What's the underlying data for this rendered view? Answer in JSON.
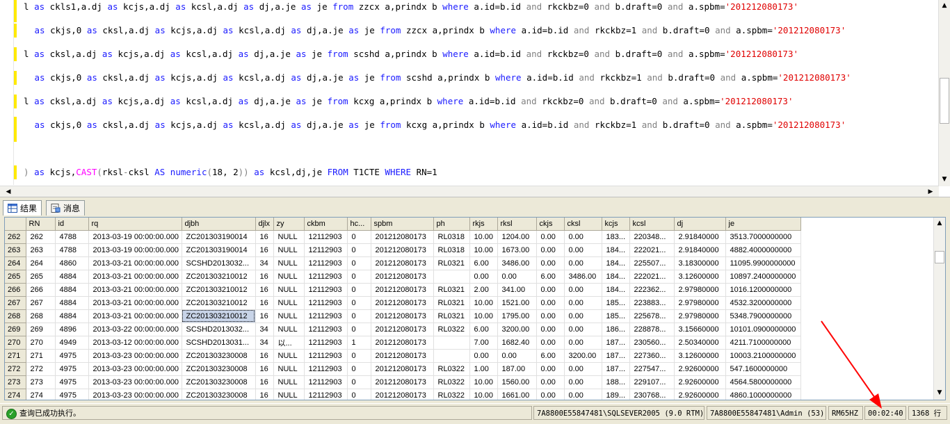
{
  "editor": {
    "lines": [
      [
        [
          "",
          "l "
        ],
        [
          "kw",
          "as"
        ],
        [
          "",
          " ckls1,a.dj "
        ],
        [
          "kw",
          "as"
        ],
        [
          "",
          " kcjs,a.dj "
        ],
        [
          "kw",
          "as"
        ],
        [
          "",
          " kcsl,a.dj "
        ],
        [
          "kw",
          "as"
        ],
        [
          "",
          " dj,a.je "
        ],
        [
          "kw",
          "as"
        ],
        [
          "",
          " je "
        ],
        [
          "kw",
          "from"
        ],
        [
          "",
          " zzcx a,prindx b "
        ],
        [
          "kw",
          "where"
        ],
        [
          "",
          " a.id=b.id "
        ],
        [
          "op",
          "and"
        ],
        [
          "",
          " rkckbz=0 "
        ],
        [
          "op",
          "and"
        ],
        [
          "",
          " b.draft=0 "
        ],
        [
          "op",
          "and"
        ],
        [
          "",
          " a.spbm="
        ],
        [
          "str",
          "'201212080173'"
        ]
      ],
      [
        [
          "",
          " "
        ],
        [
          "kw",
          "as"
        ],
        [
          "",
          " ckjs,0 "
        ],
        [
          "kw",
          "as"
        ],
        [
          "",
          " cksl,a.dj "
        ],
        [
          "kw",
          "as"
        ],
        [
          "",
          " kcjs,a.dj "
        ],
        [
          "kw",
          "as"
        ],
        [
          "",
          " kcsl,a.dj "
        ],
        [
          "kw",
          "as"
        ],
        [
          "",
          " dj,a.je "
        ],
        [
          "kw",
          "as"
        ],
        [
          "",
          " je "
        ],
        [
          "kw",
          "from"
        ],
        [
          "",
          " zzcx a,prindx b "
        ],
        [
          "kw",
          "where"
        ],
        [
          "",
          " a.id=b.id "
        ],
        [
          "op",
          "and"
        ],
        [
          "",
          " rkckbz=1 "
        ],
        [
          "op",
          "and"
        ],
        [
          "",
          " b.draft=0 "
        ],
        [
          "op",
          "and"
        ],
        [
          "",
          " a.spbm="
        ],
        [
          "str",
          "'201212080173'"
        ]
      ],
      [
        [
          "",
          "l "
        ],
        [
          "kw",
          "as"
        ],
        [
          "",
          " cksl,a.dj "
        ],
        [
          "kw",
          "as"
        ],
        [
          "",
          " kcjs,a.dj "
        ],
        [
          "kw",
          "as"
        ],
        [
          "",
          " kcsl,a.dj "
        ],
        [
          "kw",
          "as"
        ],
        [
          "",
          " dj,a.je "
        ],
        [
          "kw",
          "as"
        ],
        [
          "",
          " je "
        ],
        [
          "kw",
          "from"
        ],
        [
          "",
          " scshd a,prindx b "
        ],
        [
          "kw",
          "where"
        ],
        [
          "",
          " a.id=b.id "
        ],
        [
          "op",
          "and"
        ],
        [
          "",
          " rkckbz=0 "
        ],
        [
          "op",
          "and"
        ],
        [
          "",
          " b.draft=0 "
        ],
        [
          "op",
          "and"
        ],
        [
          "",
          " a.spbm="
        ],
        [
          "str",
          "'201212080173'"
        ]
      ],
      [
        [
          "",
          " "
        ],
        [
          "kw",
          "as"
        ],
        [
          "",
          " ckjs,0 "
        ],
        [
          "kw",
          "as"
        ],
        [
          "",
          " cksl,a.dj "
        ],
        [
          "kw",
          "as"
        ],
        [
          "",
          " kcjs,a.dj "
        ],
        [
          "kw",
          "as"
        ],
        [
          "",
          " kcsl,a.dj "
        ],
        [
          "kw",
          "as"
        ],
        [
          "",
          " dj,a.je "
        ],
        [
          "kw",
          "as"
        ],
        [
          "",
          " je "
        ],
        [
          "kw",
          "from"
        ],
        [
          "",
          " scshd a,prindx b "
        ],
        [
          "kw",
          "where"
        ],
        [
          "",
          " a.id=b.id "
        ],
        [
          "op",
          "and"
        ],
        [
          "",
          " rkckbz=1 "
        ],
        [
          "op",
          "and"
        ],
        [
          "",
          " b.draft=0 "
        ],
        [
          "op",
          "and"
        ],
        [
          "",
          " a.spbm="
        ],
        [
          "str",
          "'201212080173'"
        ]
      ],
      [
        [
          "",
          "l "
        ],
        [
          "kw",
          "as"
        ],
        [
          "",
          " cksl,a.dj "
        ],
        [
          "kw",
          "as"
        ],
        [
          "",
          " kcjs,a.dj "
        ],
        [
          "kw",
          "as"
        ],
        [
          "",
          " kcsl,a.dj "
        ],
        [
          "kw",
          "as"
        ],
        [
          "",
          " dj,a.je "
        ],
        [
          "kw",
          "as"
        ],
        [
          "",
          " je "
        ],
        [
          "kw",
          "from"
        ],
        [
          "",
          " kcxg a,prindx b "
        ],
        [
          "kw",
          "where"
        ],
        [
          "",
          " a.id=b.id "
        ],
        [
          "op",
          "and"
        ],
        [
          "",
          " rkckbz=0 "
        ],
        [
          "op",
          "and"
        ],
        [
          "",
          " b.draft=0 "
        ],
        [
          "op",
          "and"
        ],
        [
          "",
          " a.spbm="
        ],
        [
          "str",
          "'201212080173'"
        ]
      ],
      [
        [
          "",
          " "
        ],
        [
          "kw",
          "as"
        ],
        [
          "",
          " ckjs,0 "
        ],
        [
          "kw",
          "as"
        ],
        [
          "",
          " cksl,a.dj "
        ],
        [
          "kw",
          "as"
        ],
        [
          "",
          " kcjs,a.dj "
        ],
        [
          "kw",
          "as"
        ],
        [
          "",
          " kcsl,a.dj "
        ],
        [
          "kw",
          "as"
        ],
        [
          "",
          " dj,a.je "
        ],
        [
          "kw",
          "as"
        ],
        [
          "",
          " je "
        ],
        [
          "kw",
          "from"
        ],
        [
          "",
          " kcxg a,prindx b "
        ],
        [
          "kw",
          "where"
        ],
        [
          "",
          " a.id=b.id "
        ],
        [
          "op",
          "and"
        ],
        [
          "",
          " rkckbz=1 "
        ],
        [
          "op",
          "and"
        ],
        [
          "",
          " b.draft=0 "
        ],
        [
          "op",
          "and"
        ],
        [
          "",
          " a.spbm="
        ],
        [
          "str",
          "'201212080173'"
        ]
      ],
      [],
      [
        [
          "op",
          ")"
        ],
        [
          "",
          " "
        ],
        [
          "kw",
          "as"
        ],
        [
          "",
          " kcjs,"
        ],
        [
          "fn",
          "CAST"
        ],
        [
          "op",
          "("
        ],
        [
          "",
          "rksl"
        ],
        [
          "op",
          "-"
        ],
        [
          "",
          "cksl "
        ],
        [
          "kw",
          "AS"
        ],
        [
          "",
          " "
        ],
        [
          "kw",
          "numeric"
        ],
        [
          "op",
          "("
        ],
        [
          "",
          "18, 2"
        ],
        [
          "op",
          "))"
        ],
        [
          "",
          " "
        ],
        [
          "kw",
          "as"
        ],
        [
          "",
          " kcsl,dj,je "
        ],
        [
          "kw",
          "FROM"
        ],
        [
          "",
          " T1CTE "
        ],
        [
          "kw",
          "WHERE"
        ],
        [
          "",
          " RN=1"
        ]
      ]
    ]
  },
  "tabs": [
    {
      "label": "结果",
      "icon": "grid-results-icon"
    },
    {
      "label": "消息",
      "icon": "messages-icon"
    }
  ],
  "grid": {
    "columns": [
      "RN",
      "id",
      "rq",
      "djbh",
      "djlx",
      "zy",
      "ckbm",
      "hc...",
      "spbm",
      "ph",
      "rkjs",
      "rksl",
      "ckjs",
      "cksl",
      "kcjs",
      "kcsl",
      "dj",
      "je"
    ],
    "rows": [
      [
        "262",
        "262",
        "4788",
        "2013-03-19 00:00:00.000",
        "ZC201303190014",
        "16",
        "NULL",
        "12112903",
        "0",
        "201212080173",
        "RL0318",
        "10.00",
        "1204.00",
        "0.00",
        "0.00",
        "183...",
        "220348...",
        "2.91840000",
        "3513.7000000000"
      ],
      [
        "263",
        "263",
        "4788",
        "2013-03-19 00:00:00.000",
        "ZC201303190014",
        "16",
        "NULL",
        "12112903",
        "0",
        "201212080173",
        "RL0318",
        "10.00",
        "1673.00",
        "0.00",
        "0.00",
        "184...",
        "222021...",
        "2.91840000",
        "4882.4000000000"
      ],
      [
        "264",
        "264",
        "4860",
        "2013-03-21 00:00:00.000",
        "SCSHD2013032...",
        "34",
        "NULL",
        "12112903",
        "0",
        "201212080173",
        "RL0321",
        "6.00",
        "3486.00",
        "0.00",
        "0.00",
        "184...",
        "225507...",
        "3.18300000",
        "11095.9900000000"
      ],
      [
        "265",
        "265",
        "4884",
        "2013-03-21 00:00:00.000",
        "ZC201303210012",
        "16",
        "NULL",
        "12112903",
        "0",
        "201212080173",
        "",
        "0.00",
        "0.00",
        "6.00",
        "3486.00",
        "184...",
        "222021...",
        "3.12600000",
        "10897.2400000000"
      ],
      [
        "266",
        "266",
        "4884",
        "2013-03-21 00:00:00.000",
        "ZC201303210012",
        "16",
        "NULL",
        "12112903",
        "0",
        "201212080173",
        "RL0321",
        "2.00",
        "341.00",
        "0.00",
        "0.00",
        "184...",
        "222362...",
        "2.97980000",
        "1016.1200000000"
      ],
      [
        "267",
        "267",
        "4884",
        "2013-03-21 00:00:00.000",
        "ZC201303210012",
        "16",
        "NULL",
        "12112903",
        "0",
        "201212080173",
        "RL0321",
        "10.00",
        "1521.00",
        "0.00",
        "0.00",
        "185...",
        "223883...",
        "2.97980000",
        "4532.3200000000"
      ],
      [
        "268",
        "268",
        "4884",
        "2013-03-21 00:00:00.000",
        "ZC201303210012",
        "16",
        "NULL",
        "12112903",
        "0",
        "201212080173",
        "RL0321",
        "10.00",
        "1795.00",
        "0.00",
        "0.00",
        "185...",
        "225678...",
        "2.97980000",
        "5348.7900000000"
      ],
      [
        "269",
        "269",
        "4896",
        "2013-03-22 00:00:00.000",
        "SCSHD2013032...",
        "34",
        "NULL",
        "12112903",
        "0",
        "201212080173",
        "RL0322",
        "6.00",
        "3200.00",
        "0.00",
        "0.00",
        "186...",
        "228878...",
        "3.15660000",
        "10101.0900000000"
      ],
      [
        "270",
        "270",
        "4949",
        "2013-03-12 00:00:00.000",
        "SCSHD2013031...",
        "34",
        "以...",
        "12112903",
        "1",
        "201212080173",
        "",
        "7.00",
        "1682.40",
        "0.00",
        "0.00",
        "187...",
        "230560...",
        "2.50340000",
        "4211.7100000000"
      ],
      [
        "271",
        "271",
        "4975",
        "2013-03-23 00:00:00.000",
        "ZC201303230008",
        "16",
        "NULL",
        "12112903",
        "0",
        "201212080173",
        "",
        "0.00",
        "0.00",
        "6.00",
        "3200.00",
        "187...",
        "227360...",
        "3.12600000",
        "10003.2100000000"
      ],
      [
        "272",
        "272",
        "4975",
        "2013-03-23 00:00:00.000",
        "ZC201303230008",
        "16",
        "NULL",
        "12112903",
        "0",
        "201212080173",
        "RL0322",
        "1.00",
        "187.00",
        "0.00",
        "0.00",
        "187...",
        "227547...",
        "2.92600000",
        "547.1600000000"
      ],
      [
        "273",
        "273",
        "4975",
        "2013-03-23 00:00:00.000",
        "ZC201303230008",
        "16",
        "NULL",
        "12112903",
        "0",
        "201212080173",
        "RL0322",
        "10.00",
        "1560.00",
        "0.00",
        "0.00",
        "188...",
        "229107...",
        "2.92600000",
        "4564.5800000000"
      ],
      [
        "274",
        "274",
        "4975",
        "2013-03-23 00:00:00.000",
        "ZC201303230008",
        "16",
        "NULL",
        "12112903",
        "0",
        "201212080173",
        "RL0322",
        "10.00",
        "1661.00",
        "0.00",
        "0.00",
        "189...",
        "230768...",
        "2.92600000",
        "4860.1000000000"
      ]
    ]
  },
  "status": {
    "message": "查询已成功执行。",
    "server": "7A8800E55847481\\SQLSEVER2005 (9.0 RTM)",
    "user": "7A8800E55847481\\Admin (53)",
    "db": "RM65HZ",
    "time": "00:02:40",
    "rows": "1368 行"
  }
}
